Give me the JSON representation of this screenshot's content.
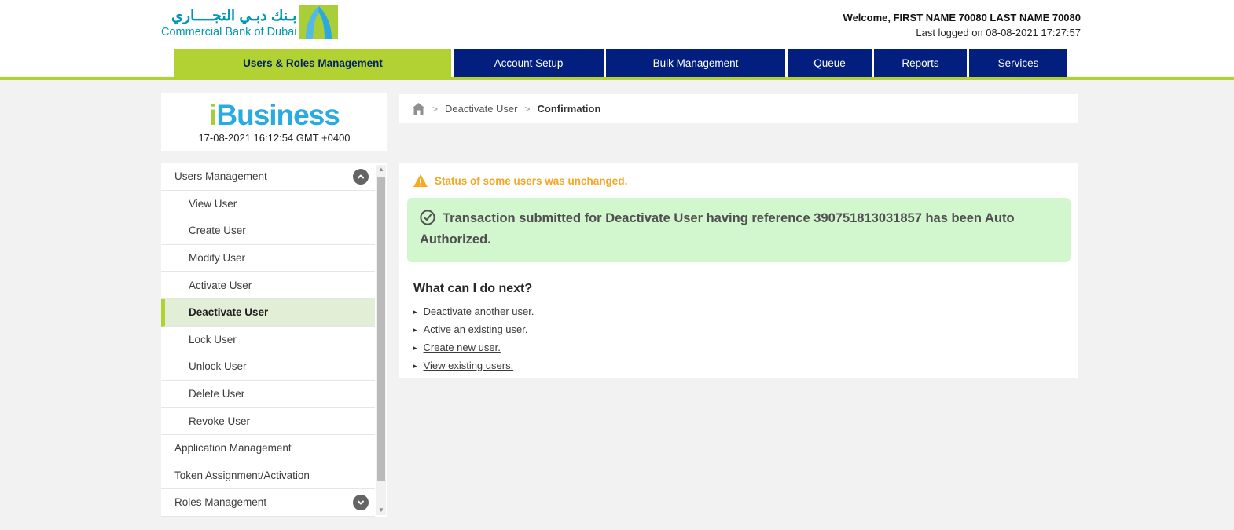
{
  "header": {
    "logo": {
      "arabic": "بـنك دبـي التجــــاري",
      "english": "Commercial Bank of Dubai"
    },
    "welcome": "Welcome, FIRST NAME 70080 LAST NAME 70080",
    "last_logged": "Last logged on 08-08-2021 17:27:57"
  },
  "nav": {
    "tabs": [
      {
        "label": "Users & Roles Management",
        "active": true
      },
      {
        "label": "Account Setup",
        "active": false
      },
      {
        "label": "Bulk Management",
        "active": false
      },
      {
        "label": "Queue",
        "active": false
      },
      {
        "label": "Reports",
        "active": false
      },
      {
        "label": "Services",
        "active": false
      }
    ]
  },
  "sidebar": {
    "brand_i": "i",
    "brand_rest": "Business",
    "timestamp": "17-08-2021 16:12:54 GMT +0400",
    "menu": [
      {
        "label": "Users Management"
      },
      {
        "label": "View User"
      },
      {
        "label": "Create User"
      },
      {
        "label": "Modify User"
      },
      {
        "label": "Activate User"
      },
      {
        "label": "Deactivate User"
      },
      {
        "label": "Lock User"
      },
      {
        "label": "Unlock User"
      },
      {
        "label": "Delete User"
      },
      {
        "label": "Revoke User"
      },
      {
        "label": "Application Management"
      },
      {
        "label": "Token Assignment/Activation"
      },
      {
        "label": "Roles Management"
      }
    ]
  },
  "breadcrumb": {
    "section": "Deactivate User",
    "page": "Confirmation"
  },
  "main": {
    "warning": "Status of some users was unchanged.",
    "success": "Transaction submitted for Deactivate User having reference 390751813031857 has been Auto Authorized.",
    "next_heading": "What can I do next?",
    "links": [
      "Deactivate another user.",
      "Active an existing user.",
      "Create new user.",
      "View existing users."
    ]
  },
  "colors": {
    "lime": "#b2d234",
    "navy": "#021e7f",
    "teal": "#0097b2",
    "brand_blue": "#29abe2",
    "success_bg": "#d2f6cd",
    "warning_orange": "#f5a623",
    "active_item_bg": "#e3eed6"
  }
}
